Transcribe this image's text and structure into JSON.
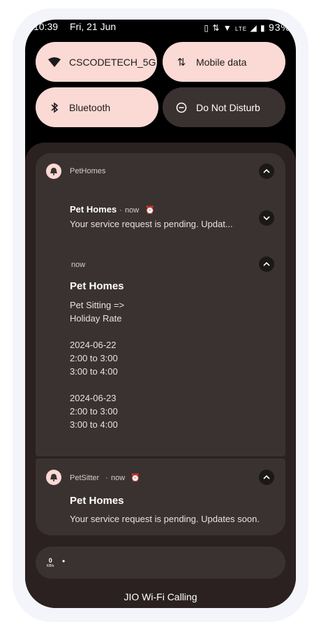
{
  "status_bar": {
    "time": "10:39",
    "date": "Fri, 21 Jun",
    "battery": "93%",
    "network": "LTE"
  },
  "quick_settings": {
    "wifi": {
      "label": "CSCODETECH_5G",
      "icon": "wifi-icon",
      "state": "on"
    },
    "mobile_data": {
      "label": "Mobile data",
      "icon": "swap-vert-icon",
      "state": "on"
    },
    "bluetooth": {
      "label": "Bluetooth",
      "icon": "bluetooth-icon",
      "state": "on"
    },
    "dnd": {
      "label": "Do Not Disturb",
      "icon": "minus-circle-icon",
      "state": "off"
    }
  },
  "notification_group": {
    "app_name": "PetHomes",
    "summary": {
      "title": "Pet Homes",
      "time": "now",
      "text": "Your service request is pending. Updat..."
    },
    "expanded": {
      "time": "now",
      "title": "Pet Homes",
      "body_lines": [
        "Pet Sitting =>",
        "Holiday Rate",
        "",
        "2024-06-22",
        "2:00 to 3:00",
        "3:00 to 4:00",
        "",
        "2024-06-23",
        "2:00 to 3:00",
        "3:00 to 4:00"
      ]
    }
  },
  "notification_petsitter": {
    "app_name": "PetSitter",
    "time": "now",
    "title": "Pet Homes",
    "text": "Your service request is pending. Updates soon."
  },
  "speed_indicator": {
    "value": "0",
    "unit": "KB/s"
  },
  "footer": {
    "carrier": "JIO Wi-Fi Calling"
  },
  "colors": {
    "accent_tile": "#fbd9d4",
    "card": "#3a3230",
    "shade": "#2a2120"
  }
}
